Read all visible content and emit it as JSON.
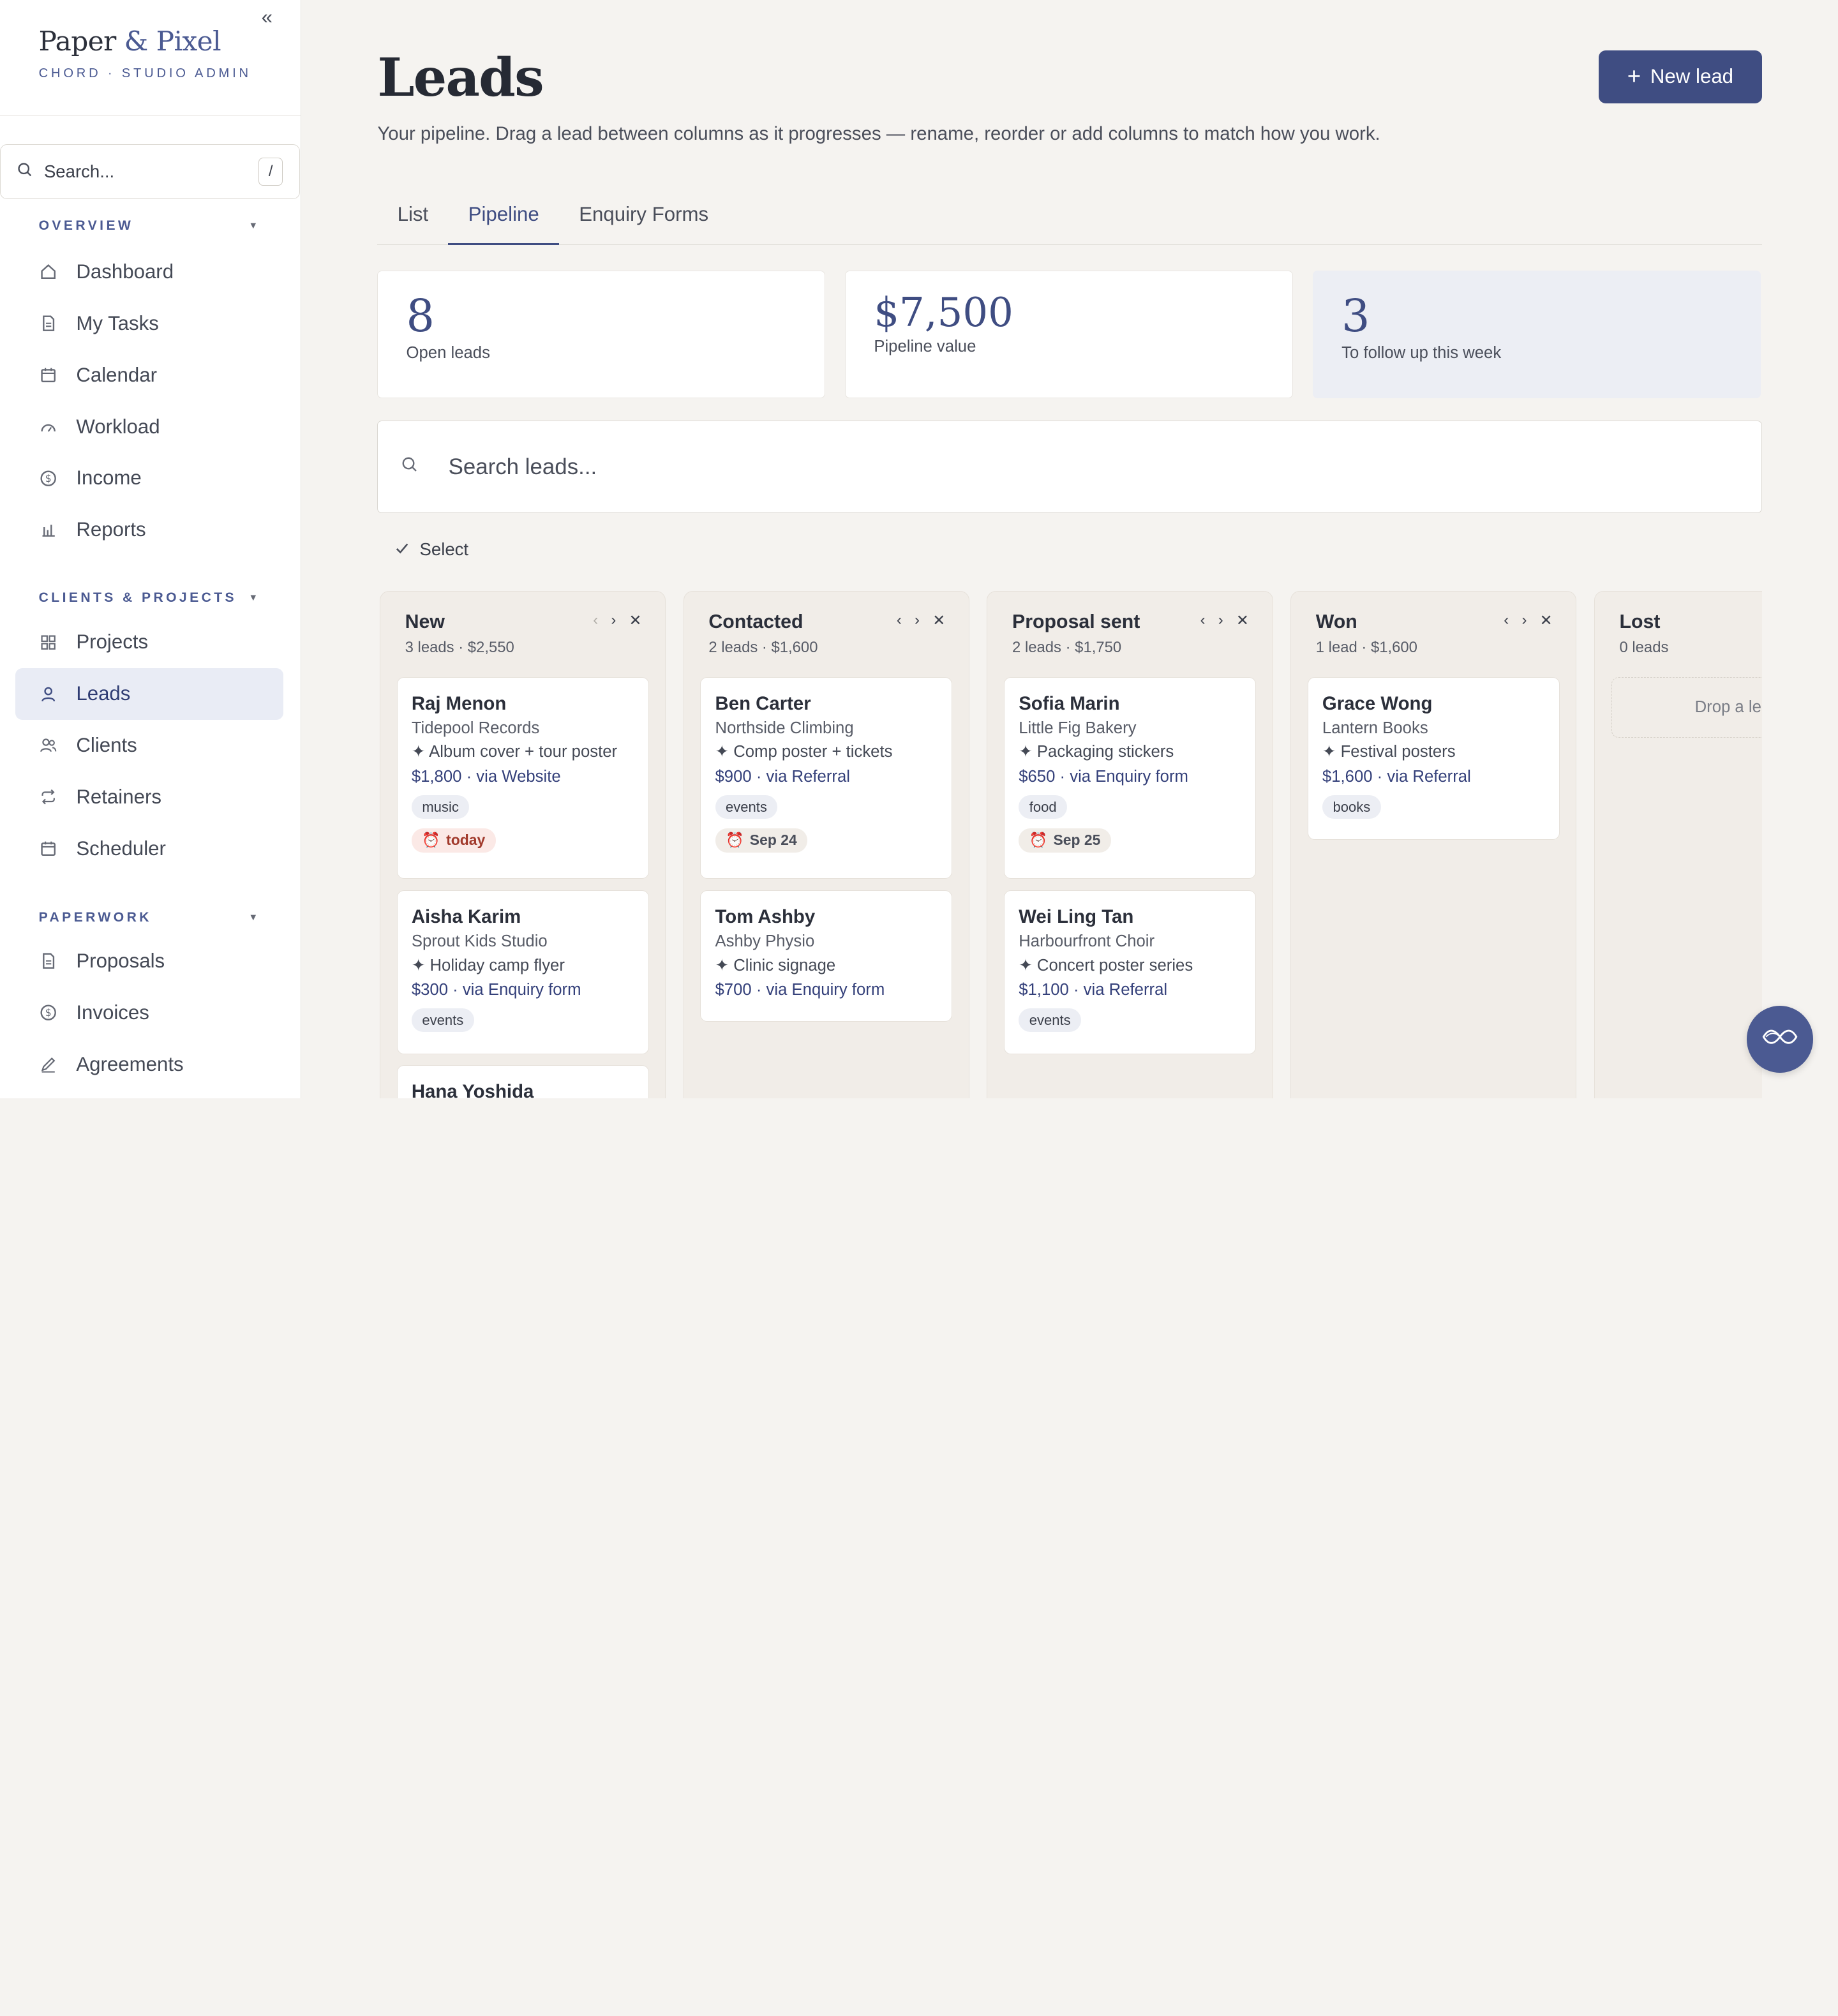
{
  "brand": {
    "name_main": "Paper ",
    "name_amp": "& Pixel",
    "subtitle": "CHORD · STUDIO ADMIN",
    "collapse": "«"
  },
  "sidebar": {
    "search_placeholder": "Search...",
    "search_shortcut": "/",
    "sections": [
      {
        "title": "OVERVIEW",
        "items": [
          {
            "label": "Dashboard",
            "icon": "home-icon"
          },
          {
            "label": "My Tasks",
            "icon": "document-icon"
          },
          {
            "label": "Calendar",
            "icon": "calendar-icon"
          },
          {
            "label": "Workload",
            "icon": "gauge-icon"
          },
          {
            "label": "Income",
            "icon": "dollar-icon"
          },
          {
            "label": "Reports",
            "icon": "bar-chart-icon"
          }
        ]
      },
      {
        "title": "CLIENTS & PROJECTS",
        "items": [
          {
            "label": "Projects",
            "icon": "grid-icon"
          },
          {
            "label": "Leads",
            "icon": "user-icon",
            "active": true
          },
          {
            "label": "Clients",
            "icon": "users-icon"
          },
          {
            "label": "Retainers",
            "icon": "repeat-icon"
          },
          {
            "label": "Scheduler",
            "icon": "calendar-icon"
          }
        ]
      },
      {
        "title": "PAPERWORK",
        "items": [
          {
            "label": "Proposals",
            "icon": "document-icon"
          },
          {
            "label": "Invoices",
            "icon": "dollar-icon"
          },
          {
            "label": "Agreements",
            "icon": "pen-icon"
          }
        ]
      }
    ]
  },
  "header": {
    "title": "Leads",
    "subtitle": "Your pipeline. Drag a lead between columns as it progresses — rename, reorder or add columns to match how you work.",
    "new_lead_label": "New lead"
  },
  "tabs": [
    {
      "label": "List",
      "active": false
    },
    {
      "label": "Pipeline",
      "active": true
    },
    {
      "label": "Enquiry Forms",
      "active": false
    }
  ],
  "stats": [
    {
      "value": "8",
      "label": "Open leads"
    },
    {
      "value": "$7,500",
      "label": "Pipeline value"
    },
    {
      "value": "3",
      "label": "To follow up this week"
    }
  ],
  "lead_search_placeholder": "Search leads...",
  "select_label": "Select",
  "columns": [
    {
      "title": "New",
      "meta": "3 leads · $2,550",
      "cards": [
        {
          "name": "Raj Menon",
          "company": "Tidepool Records",
          "project": "✦ Album cover + tour poster",
          "value": "$1,800 · via Website",
          "tag": "music",
          "due": "today"
        },
        {
          "name": "Aisha Karim",
          "company": "Sprout Kids Studio",
          "project": "✦ Holiday camp flyer",
          "value": "$300 · via Enquiry form",
          "tag": "events"
        },
        {
          "name": "Hana Yoshida"
        }
      ]
    },
    {
      "title": "Contacted",
      "meta": "2 leads · $1,600",
      "cards": [
        {
          "name": "Ben Carter",
          "company": "Northside Climbing",
          "project": "✦ Comp poster + tickets",
          "value": "$900 · via Referral",
          "tag": "events",
          "due": "Sep 24"
        },
        {
          "name": "Tom Ashby",
          "company": "Ashby Physio",
          "project": "✦ Clinic signage",
          "value": "$700 · via Enquiry form"
        }
      ]
    },
    {
      "title": "Proposal sent",
      "meta": "2 leads · $1,750",
      "cards": [
        {
          "name": "Sofia Marin",
          "company": "Little Fig Bakery",
          "project": "✦ Packaging stickers",
          "value": "$650 · via Enquiry form",
          "tag": "food",
          "due": "Sep 25"
        },
        {
          "name": "Wei Ling Tan",
          "company": "Harbourfront Choir",
          "project": "✦ Concert poster series",
          "value": "$1,100 · via Referral",
          "tag": "events"
        }
      ]
    },
    {
      "title": "Won",
      "meta": "1 lead · $1,600",
      "cards": [
        {
          "name": "Grace Wong",
          "company": "Lantern Books",
          "project": "✦ Festival posters",
          "value": "$1,600 · via Referral",
          "tag": "books"
        }
      ]
    },
    {
      "title": "Lost",
      "meta": "0 leads",
      "drop_text": "Drop a lead"
    }
  ],
  "colors": {
    "accent": "#3f4d82",
    "active_nav_bg": "#e9ecf5",
    "column_bg": "#f1ede8",
    "overdue": "#a13a2c"
  }
}
